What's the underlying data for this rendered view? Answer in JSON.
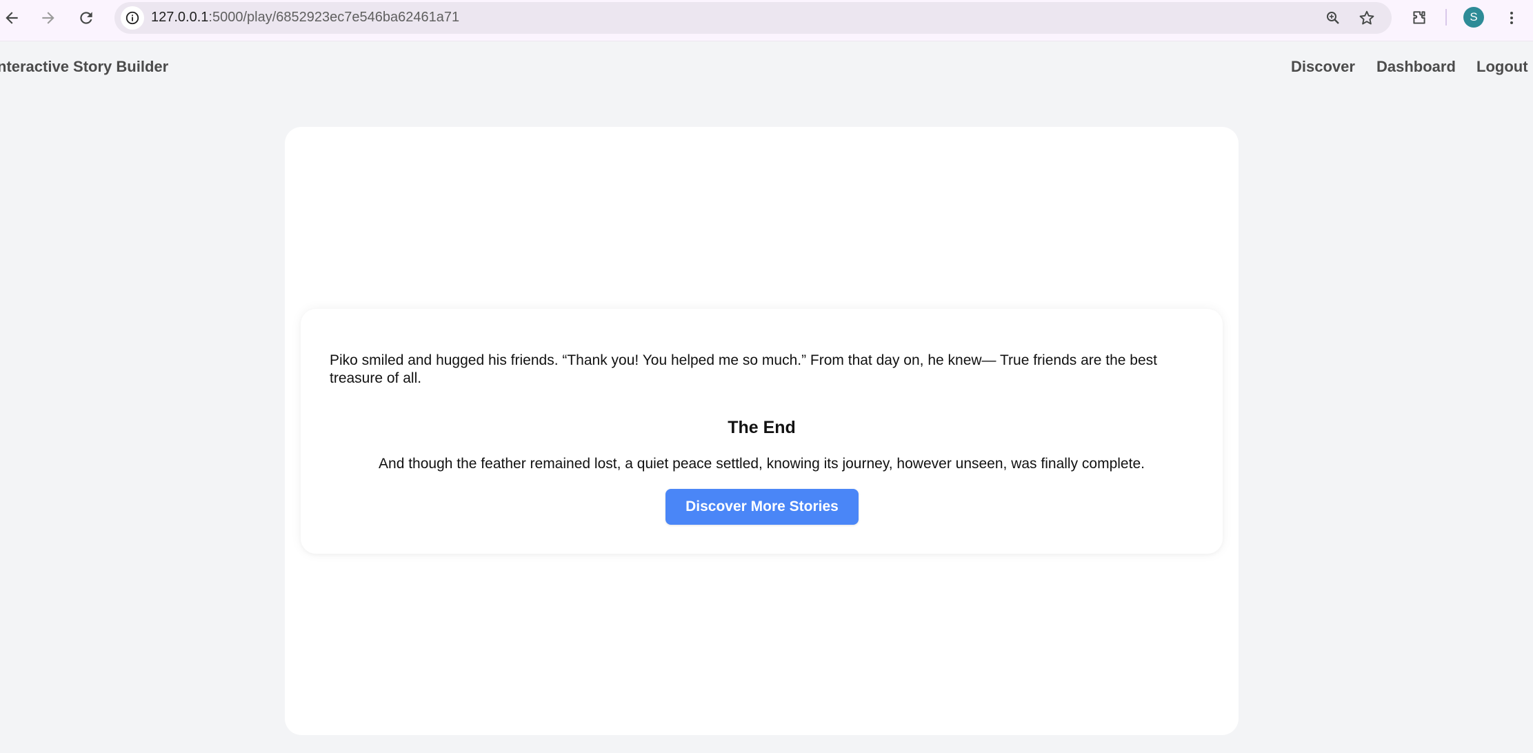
{
  "browser": {
    "url_host": "127.0.0.1",
    "url_path": ":5000/play/6852923ec7e546ba62461a71",
    "profile_initial": "S"
  },
  "header": {
    "brand": "nteractive Story Builder",
    "nav": {
      "discover": "Discover",
      "dashboard": "Dashboard",
      "logout": "Logout"
    }
  },
  "story": {
    "passage": "Piko smiled and hugged his friends. “Thank you! You helped me so much.” From that day on, he knew— True friends are the best treasure of all.",
    "end_title": "The End",
    "end_text": "And though the feather remained lost, a quiet peace settled, knowing its journey, however unseen, was finally complete.",
    "cta_label": "Discover More Stories"
  },
  "colors": {
    "page_bg": "#f3f4f6",
    "button": "#4a86f7",
    "avatar": "#2e8b97"
  }
}
